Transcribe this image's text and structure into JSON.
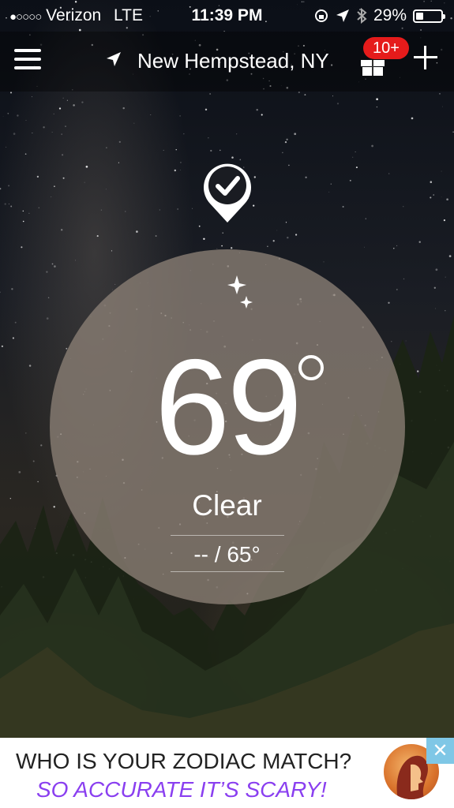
{
  "status_bar": {
    "signal": "●○○○○",
    "carrier": "Verizon",
    "network": "LTE",
    "time": "11:39 PM",
    "battery_text": "29%",
    "battery_level": 0.29
  },
  "header": {
    "location": "New Hempstead, NY",
    "badge": "10+"
  },
  "weather": {
    "temperature": "69",
    "condition": "Clear",
    "high_low": "-- / 65°"
  },
  "ad": {
    "line1": "WHO IS YOUR ZODIAC MATCH?",
    "line2": "SO ACCURATE IT’S SCARY!",
    "close": "✕"
  },
  "colors": {
    "badge": "#e51b1b",
    "ad_accent": "#8a3ff0",
    "ad_close_bg": "#7fc7e6"
  }
}
